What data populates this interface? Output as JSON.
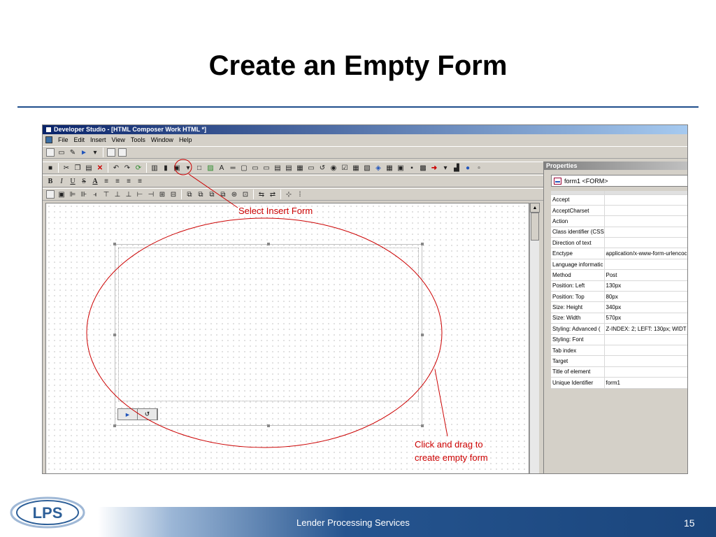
{
  "slide": {
    "title": "Create an Empty Form",
    "footer_text": "Lender Processing Services",
    "page_number": "15",
    "logo_text": "LPS"
  },
  "window": {
    "title": "Developer Studio - [HTML Composer Work HTML *]"
  },
  "menu": {
    "items": [
      "File",
      "Edit",
      "Insert",
      "View",
      "Tools",
      "Window",
      "Help"
    ]
  },
  "format_toolbar": {
    "bold": "B",
    "italic": "I",
    "underline": "U",
    "strike": "S",
    "font_color": "A"
  },
  "properties": {
    "header": "Properties",
    "selected_object": "form1 <FORM>",
    "rows": [
      {
        "name": "Accept",
        "value": ""
      },
      {
        "name": "AcceptCharset",
        "value": ""
      },
      {
        "name": "Action",
        "value": ""
      },
      {
        "name": "Class identifier (CSS",
        "value": ""
      },
      {
        "name": "Direction of text",
        "value": ""
      },
      {
        "name": "Enctype",
        "value": "application/x-www-form-urlencoc"
      },
      {
        "name": "Language informatic",
        "value": ""
      },
      {
        "name": "Method",
        "value": "Post"
      },
      {
        "name": "Position: Left",
        "value": "130px"
      },
      {
        "name": "Position: Top",
        "value": "80px"
      },
      {
        "name": "Size: Height",
        "value": "340px"
      },
      {
        "name": "Size: Width",
        "value": "570px"
      },
      {
        "name": "Styling: Advanced (",
        "value": "Z-INDEX: 2; LEFT: 130px; WIDT"
      },
      {
        "name": "Styling: Font",
        "value": ""
      },
      {
        "name": "Tab index",
        "value": ""
      },
      {
        "name": "Target",
        "value": ""
      },
      {
        "name": "Title of element",
        "value": ""
      },
      {
        "name": "Unique Identifier",
        "value": "form1"
      }
    ]
  },
  "annotations": {
    "insert_form": "Select Insert Form",
    "drag_line1": "Click and drag to",
    "drag_line2": "create empty form"
  },
  "colors": {
    "annotation": "#cc0000",
    "title_rule": "#1f4e8c",
    "footer_band": "#1a457c"
  }
}
